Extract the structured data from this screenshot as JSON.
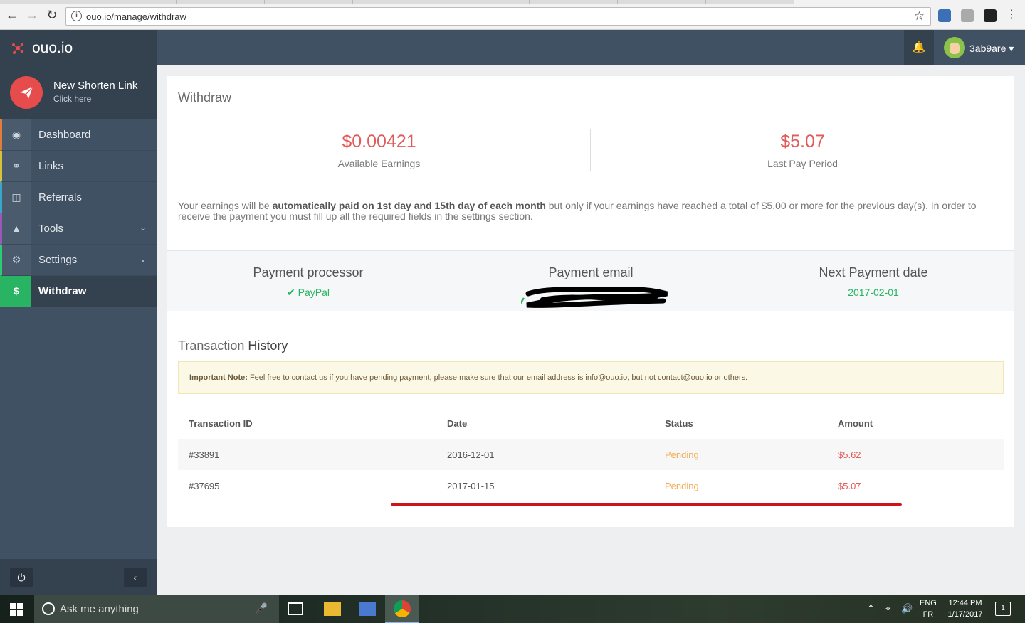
{
  "browser": {
    "url": "ouo.io/manage/withdraw"
  },
  "sidebar": {
    "logo": "ouo.io",
    "new_link": {
      "title": "New Shorten Link",
      "subtitle": "Click here"
    },
    "items": [
      {
        "label": "Dashboard",
        "icon": "dashboard-icon",
        "accent": "#e07d3c"
      },
      {
        "label": "Links",
        "icon": "link-icon",
        "accent": "#d8c13b"
      },
      {
        "label": "Referrals",
        "icon": "referrals-icon",
        "accent": "#3aa7c9"
      },
      {
        "label": "Tools",
        "icon": "flask-icon",
        "accent": "#9b59b6"
      },
      {
        "label": "Settings",
        "icon": "gear-icon",
        "accent": "#2ecc71"
      },
      {
        "label": "Withdraw",
        "icon": "dollar-icon",
        "accent": "#28b463",
        "active": true
      }
    ]
  },
  "topbar": {
    "username": "3ab9are"
  },
  "withdraw": {
    "title": "Withdraw",
    "available": {
      "value": "$0.00421",
      "label": "Available Earnings"
    },
    "last_period": {
      "value": "$5.07",
      "label": "Last Pay Period"
    },
    "note_pre": "Your earnings will be ",
    "note_bold": "automatically paid on 1st day and 15th day of each month",
    "note_post": " but only if your earnings have reached a total of $5.00 or more for the previous day(s). In order to receive the payment you must fill up all the required fields in the settings section."
  },
  "payment": {
    "processor": {
      "label": "Payment processor",
      "value": "PayPal"
    },
    "email": {
      "label": "Payment email"
    },
    "next_date": {
      "label": "Next Payment date",
      "value": "2017-02-01"
    }
  },
  "history": {
    "title_light": "Transaction ",
    "title_bold": "History",
    "alert_bold": "Important Note:",
    "alert_text": " Feel free to contact us if you have pending payment, please make sure that our email address is info@ouo.io, but not contact@ouo.io or others.",
    "columns": [
      "Transaction ID",
      "Date",
      "Status",
      "Amount"
    ],
    "rows": [
      {
        "id": "#33891",
        "date": "2016-12-01",
        "status": "Pending",
        "amount": "$5.62"
      },
      {
        "id": "#37695",
        "date": "2017-01-15",
        "status": "Pending",
        "amount": "$5.07"
      }
    ]
  },
  "taskbar": {
    "search_placeholder": "Ask me anything",
    "lang_top": "ENG",
    "lang_bottom": "FR",
    "time": "12:44 PM",
    "date": "1/17/2017",
    "notification_count": "1"
  },
  "colors": {
    "sidebar": "#405164",
    "accent_red": "#e05b5b",
    "success": "#28b463",
    "pending": "#f0ad4e"
  }
}
